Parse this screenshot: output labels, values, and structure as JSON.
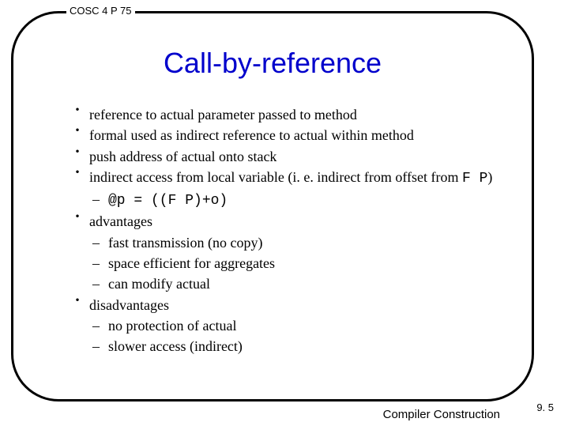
{
  "course_label": "COSC 4 P 75",
  "title": "Call-by-reference",
  "bullets": [
    {
      "text": "reference to actual parameter passed to method"
    },
    {
      "text": "formal used as indirect reference to actual within method"
    },
    {
      "text": "push address of actual onto stack"
    },
    {
      "text_prefix": "indirect access from local variable (i. e. indirect from offset from ",
      "text_mono": "F P",
      "text_suffix": ")",
      "sub": [
        {
          "mono": "@p = ((F P)+o)"
        }
      ]
    },
    {
      "text": "advantages",
      "sub": [
        {
          "text": "fast transmission (no copy)"
        },
        {
          "text": "space efficient for aggregates"
        },
        {
          "text": "can modify actual"
        }
      ]
    },
    {
      "text": "disadvantages",
      "sub": [
        {
          "text": "no protection of actual"
        },
        {
          "text": "slower access (indirect)"
        }
      ]
    }
  ],
  "footer_title": "Compiler Construction",
  "slide_number": "9. 5"
}
